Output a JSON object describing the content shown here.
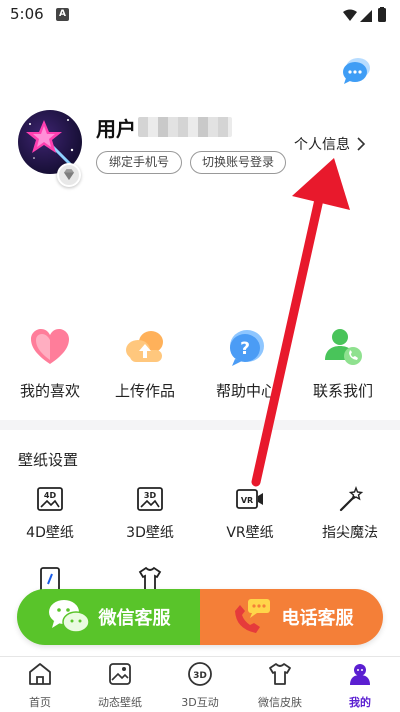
{
  "status": {
    "time": "5:06",
    "notif_letter": "A"
  },
  "profile": {
    "username": "用户",
    "bind_phone": "绑定手机号",
    "switch_account": "切换账号登录",
    "profile_link": "个人信息"
  },
  "quick_actions": [
    {
      "label": "我的喜欢",
      "icon": "heart-icon"
    },
    {
      "label": "上传作品",
      "icon": "cloud-upload-icon"
    },
    {
      "label": "帮助中心",
      "icon": "help-icon"
    },
    {
      "label": "联系我们",
      "icon": "contact-icon"
    }
  ],
  "wallpaper_settings": {
    "title": "壁纸设置",
    "items": [
      {
        "label": "4D壁纸",
        "icon": "wallpaper-4d-icon"
      },
      {
        "label": "3D壁纸",
        "icon": "wallpaper-3d-icon"
      },
      {
        "label": "VR壁纸",
        "icon": "wallpaper-vr-icon"
      },
      {
        "label": "指尖魔法",
        "icon": "magic-wand-icon"
      }
    ]
  },
  "service": {
    "wechat": "微信客服",
    "phone": "电话客服",
    "wechat_color": "#59c42a",
    "phone_color": "#f47f38"
  },
  "tabs": [
    {
      "label": "首页",
      "icon": "home-icon"
    },
    {
      "label": "动态壁纸",
      "icon": "live-wallpaper-icon"
    },
    {
      "label": "3D互动",
      "icon": "3d-icon"
    },
    {
      "label": "微信皮肤",
      "icon": "shirt-icon"
    },
    {
      "label": "我的",
      "icon": "profile-icon",
      "active": true
    }
  ],
  "colors": {
    "accent": "#5b1fd1",
    "arrow": "#e8192c"
  }
}
